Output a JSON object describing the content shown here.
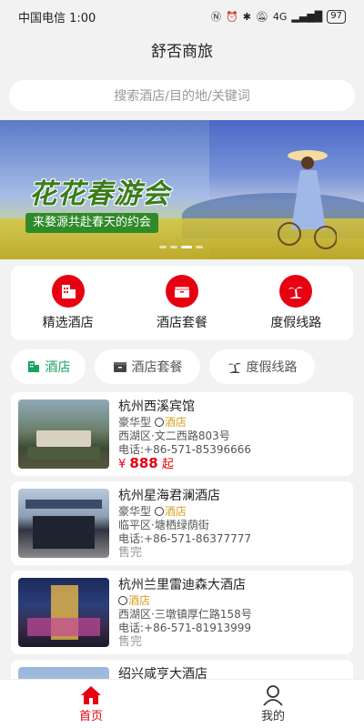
{
  "status_bar": {
    "carrier_time": "中国电信 1:00",
    "network": "4G",
    "battery": "97"
  },
  "header": {
    "title": "舒否商旅"
  },
  "search": {
    "placeholder": "搜索酒店/目的地/关键词"
  },
  "banner": {
    "title": "花花春游会",
    "subtitle": "来婺源共赴春天的约会"
  },
  "categories": [
    {
      "label": "精选酒店",
      "icon": "hotel-building-icon"
    },
    {
      "label": "酒店套餐",
      "icon": "package-icon"
    },
    {
      "label": "度假线路",
      "icon": "palm-tree-icon"
    }
  ],
  "tabs": [
    {
      "label": "酒店",
      "icon": "hotel-building-icon",
      "active": true
    },
    {
      "label": "酒店套餐",
      "icon": "package-icon",
      "active": false
    },
    {
      "label": "度假线路",
      "icon": "palm-tree-icon",
      "active": false
    }
  ],
  "hotels": [
    {
      "name": "杭州西溪宾馆",
      "grade": "豪华型",
      "type": "酒店",
      "address": "西湖区·文二西路803号",
      "phone": "电话:+86-571-85396666",
      "price_symbol": "¥",
      "price": "888",
      "price_suffix": "起"
    },
    {
      "name": "杭州星海君澜酒店",
      "grade": "豪华型",
      "type": "酒店",
      "address": "临平区·塘栖绿荫街",
      "phone": "电话:+86-571-86377777",
      "status": "售完"
    },
    {
      "name": "杭州兰里雷迪森大酒店",
      "type": "酒店",
      "address": "西湖区·三墩镇厚仁路158号",
      "phone": "电话:+86-571-81913999",
      "status": "售完"
    },
    {
      "name": "绍兴咸亨大酒店"
    }
  ],
  "bottom_nav": [
    {
      "label": "首页",
      "icon": "home-icon",
      "active": true
    },
    {
      "label": "我的",
      "icon": "user-icon",
      "active": false
    }
  ],
  "colors": {
    "accent": "#e60012",
    "tab_active": "#1aa260",
    "tag": "#d4a020"
  }
}
